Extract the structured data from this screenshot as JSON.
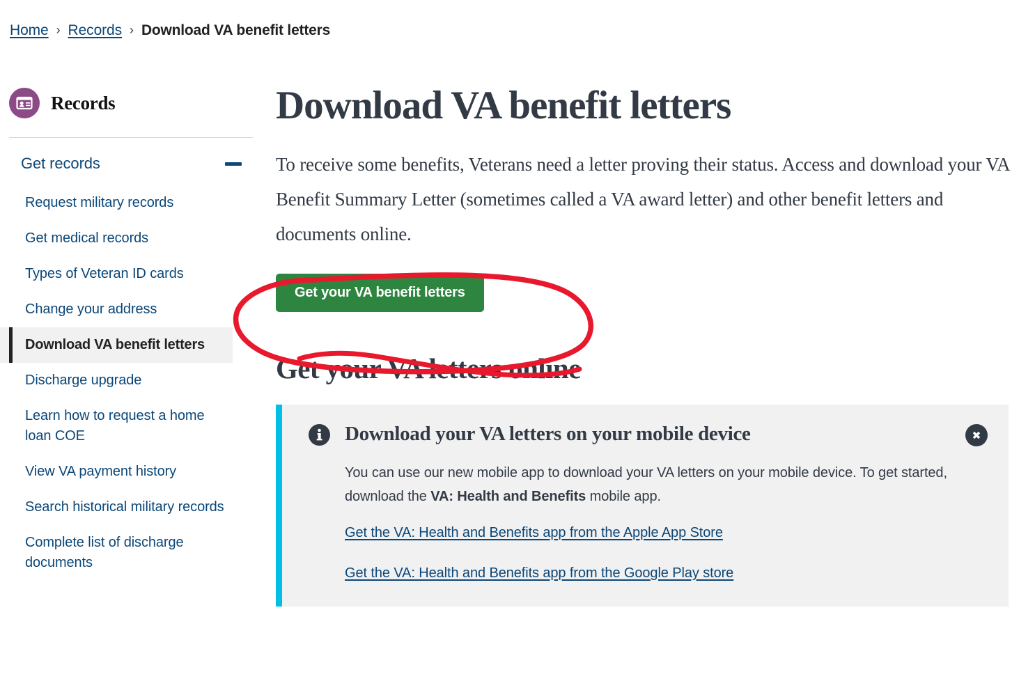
{
  "breadcrumb": {
    "items": [
      {
        "label": "Home",
        "current": false
      },
      {
        "label": "Records",
        "current": false
      },
      {
        "label": "Download VA benefit letters",
        "current": true
      }
    ],
    "separator": "›"
  },
  "sidebar": {
    "hub_title": "Records",
    "hub_icon": "id-card-icon",
    "hub_icon_color": "#8c4a86",
    "section": {
      "label": "Get records",
      "expanded": true,
      "collapse_icon": "minus-icon"
    },
    "items": [
      {
        "label": "Request military records",
        "active": false
      },
      {
        "label": "Get medical records",
        "active": false
      },
      {
        "label": "Types of Veteran ID cards",
        "active": false
      },
      {
        "label": "Change your address",
        "active": false
      },
      {
        "label": "Download VA benefit letters",
        "active": true
      },
      {
        "label": "Discharge upgrade",
        "active": false
      },
      {
        "label": "Learn how to request a home loan COE",
        "active": false
      },
      {
        "label": "View VA payment history",
        "active": false
      },
      {
        "label": "Search historical military records",
        "active": false
      },
      {
        "label": "Complete list of discharge documents",
        "active": false
      }
    ]
  },
  "main": {
    "title": "Download VA benefit letters",
    "intro": "To receive some benefits, Veterans need a letter proving their status. Access and download your VA Benefit Summary Letter (sometimes called a VA award letter) and other benefit letters and documents online.",
    "primary_button": "Get your VA benefit letters",
    "primary_button_color": "#2e8540",
    "section_title": "Get your VA letters online",
    "alert": {
      "icon": "info-circle-icon",
      "accent_color": "#02bfe7",
      "background_color": "#f1f1f1",
      "title": "Download your VA letters on your mobile device",
      "body_part1": "You can use our new mobile app to download your VA letters on your mobile device. To get started, download the ",
      "body_strong": "VA: Health and Benefits",
      "body_part2": " mobile app.",
      "close_icon": "close-circle-icon",
      "links": [
        "Get the VA: Health and Benefits app from the Apple App Store",
        "Get the VA: Health and Benefits app from the Google Play store"
      ]
    }
  },
  "annotation": {
    "type": "hand-drawn-ellipse",
    "color": "#e8192c",
    "target": "Get your VA benefit letters"
  }
}
